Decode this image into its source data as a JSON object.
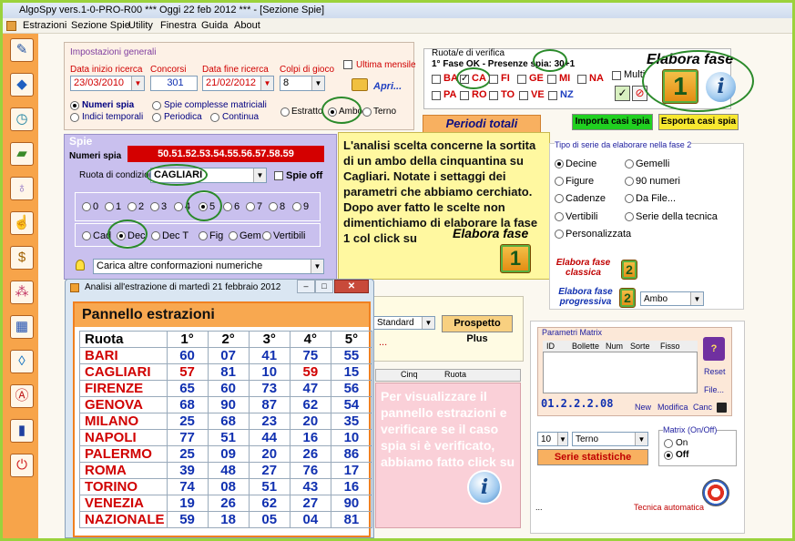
{
  "window": {
    "title": "AlgoSpy vers.1-0-PRO-R00  ***  Oggi 22 feb 2012  ***  - [Sezione Spie]"
  },
  "menu": [
    "Estrazioni",
    "Sezione Spie",
    "Utility",
    "Finestra",
    "Guida",
    "About"
  ],
  "toolbar_icons": [
    "pencil-icon",
    "eraser-icon",
    "clock-icon",
    "money-icon",
    "bulb-icon",
    "thumb-icon",
    "dollar-icon",
    "molecule-icon",
    "calendar-icon",
    "drop-icon",
    "compass-icon",
    "book-icon",
    "power-icon"
  ],
  "impostazioni": {
    "title": "Impostazioni generali",
    "data_inizio_label": "Data inizio ricerca",
    "data_inizio": "23/03/2010",
    "concorsi_label": "Concorsi",
    "concorsi": "301",
    "data_fine_label": "Data fine ricerca",
    "data_fine": "21/02/2012",
    "colpi_label": "Colpi di gioco",
    "colpi": "8",
    "ultima_mensile": "Ultima mensile",
    "apri": "Apri...",
    "numeri_spia": "Numeri spia",
    "spie_complesse": "Spie complesse matriciali",
    "indici_temporali": "Indici temporali",
    "periodica": "Periodica",
    "continua": "Continua",
    "estratto": "Estratto",
    "ambo": "Ambo",
    "terno": "Terno"
  },
  "ruota_verifica": {
    "title": "Ruota/e di verifica",
    "fase_label": "1° Fase OK - Presenze spia: 30+1",
    "ruote_row1": [
      "BA",
      "CA",
      "FI",
      "GE",
      "MI",
      "NA"
    ],
    "ruote_row2": [
      "PA",
      "RO",
      "TO",
      "VE",
      "NZ"
    ],
    "multi": "Multi"
  },
  "elabora_fase": {
    "label": "Elabora fase",
    "number": "1"
  },
  "periodi_totali": "Periodi totali",
  "importa_button": "Importa casi spia",
  "esporta_button": "Esporta casi spia",
  "spie": {
    "title": "Spie",
    "numeri_spia_label": "Numeri spia",
    "numeri_spia_value": "50.51.52.53.54.55.56.57.58.59",
    "ruota_condizione_label": "Ruota di condizione",
    "ruota_condizione": "CAGLIARI",
    "spie_off": "Spie off",
    "cifre": [
      "0",
      "1",
      "2",
      "3",
      "4",
      "5",
      "6",
      "7",
      "8",
      "9"
    ],
    "tipi": [
      "Cad",
      "Dec",
      "Dec T",
      "Fig",
      "Gem",
      "Vertibili"
    ],
    "carica": "Carica altre conformazioni numeriche"
  },
  "note1": {
    "text": "L'analisi scelta concerne la sortita di un ambo della cinquantina su Cagliari. Notate i settaggi dei parametri che abbiamo cerchiato. Dopo aver fatto le scelte non dimentichiamo di elaborare la fase 1 col click su",
    "elabora": "Elabora fase"
  },
  "tipo_serie": {
    "title": "Tipo di serie da elaborare nella fase 2",
    "col1": [
      "Decine",
      "Figure",
      "Cadenze",
      "Vertibili",
      "Personalizzata"
    ],
    "col2": [
      "Gemelli",
      "90 numeri",
      "Da File...",
      "Serie della tecnica"
    ]
  },
  "elabora_classica": "Elabora fase classica",
  "elabora_progressiva": "Elabora fase progressiva",
  "fase2_number": "2",
  "progressiva_select": "Ambo",
  "standard_select": "Standard",
  "prospetto_plus": "Prospetto Plus",
  "grid_headers": [
    "Cinq",
    "Ruota"
  ],
  "note2": {
    "text": "Per visualizzare il pannello estrazioni e verificare se il caso spia si è verificato, abbiamo fatto click su"
  },
  "matrix": {
    "title": "Parametri Matrix",
    "headers": [
      "ID",
      "Bollette",
      "Num",
      "Sorte",
      "Fisso"
    ],
    "code": "01.2.2.2.08",
    "new": "New",
    "modifica": "Modifica",
    "canc": "Canc",
    "reset": "Reset",
    "file": "File...",
    "colpi": "10",
    "sorte": "Terno",
    "serie_statistiche": "Serie statistiche",
    "onoff_title": "Matrix (On/Off)",
    "on": "On",
    "off": "Off",
    "tecnica": "Tecnica automatica",
    "dots": "..."
  },
  "estrazioni_window": {
    "title": "Analisi all'estrazione di martedì 21 febbraio 2012",
    "panel_title": "Pannello estrazioni",
    "headers": [
      "Ruota",
      "1°",
      "2°",
      "3°",
      "4°",
      "5°"
    ],
    "rows": [
      {
        "ruota": "BARI",
        "nums": [
          "60",
          "07",
          "41",
          "75",
          "55"
        ]
      },
      {
        "ruota": "CAGLIARI",
        "nums": [
          "57",
          "81",
          "10",
          "59",
          "15"
        ]
      },
      {
        "ruota": "FIRENZE",
        "nums": [
          "65",
          "60",
          "73",
          "47",
          "56"
        ]
      },
      {
        "ruota": "GENOVA",
        "nums": [
          "68",
          "90",
          "87",
          "62",
          "54"
        ]
      },
      {
        "ruota": "MILANO",
        "nums": [
          "25",
          "68",
          "23",
          "20",
          "35"
        ]
      },
      {
        "ruota": "NAPOLI",
        "nums": [
          "77",
          "51",
          "44",
          "16",
          "10"
        ]
      },
      {
        "ruota": "PALERMO",
        "nums": [
          "25",
          "09",
          "20",
          "26",
          "86"
        ]
      },
      {
        "ruota": "ROMA",
        "nums": [
          "39",
          "48",
          "27",
          "76",
          "17"
        ]
      },
      {
        "ruota": "TORINO",
        "nums": [
          "74",
          "08",
          "51",
          "43",
          "16"
        ]
      },
      {
        "ruota": "VENEZIA",
        "nums": [
          "19",
          "26",
          "62",
          "27",
          "90"
        ]
      },
      {
        "ruota": "NAZIONALE",
        "nums": [
          "59",
          "18",
          "05",
          "04",
          "81"
        ]
      }
    ]
  }
}
